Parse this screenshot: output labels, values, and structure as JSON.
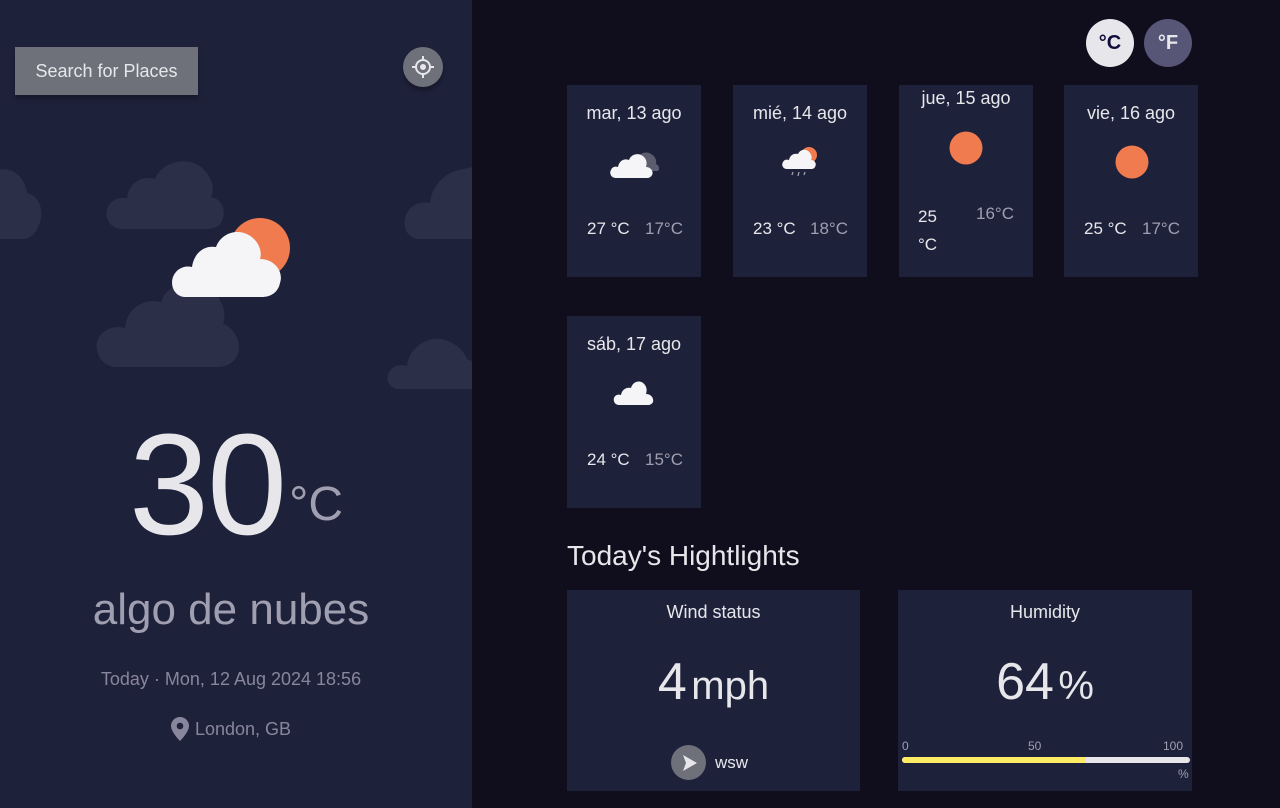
{
  "sidebar": {
    "search_label": "Search for Places",
    "locate_icon": "crosshair-icon",
    "weather_icon": "sun-behind-cloud-icon",
    "temp": "30",
    "temp_unit": "°C",
    "description": "algo de nubes",
    "date": "Today · Mon, 12 Aug 2024 18:56",
    "location_icon": "map-pin-icon",
    "location": "London, GB"
  },
  "units": {
    "celsius": "°C",
    "fahrenheit": "°F",
    "active": "celsius"
  },
  "forecast": [
    {
      "date": "mar, 13 ago",
      "icon": "overcast-clouds-icon",
      "max": "27 °C",
      "min": "17°C"
    },
    {
      "date": "mié, 14 ago",
      "icon": "sun-cloud-rain-icon",
      "max": "23 °C",
      "min": "18°C"
    },
    {
      "date": "jue, 15 ago",
      "icon": "sun-icon",
      "max": "25 °C",
      "min": "16°C"
    },
    {
      "date": "vie, 16 ago",
      "icon": "sun-icon",
      "max": "25 °C",
      "min": "17°C"
    },
    {
      "date": "sáb, 17 ago",
      "icon": "cloud-icon",
      "max": "24 °C",
      "min": "15°C"
    }
  ],
  "highlights": {
    "title": "Today's Hightlights",
    "wind": {
      "label": "Wind status",
      "value": "4",
      "unit": "mph",
      "direction": "wsw",
      "direction_icon": "navigation-arrow-icon"
    },
    "humidity": {
      "label": "Humidity",
      "value": "64",
      "unit": "%",
      "percent": 64,
      "scale": [
        "0",
        "50",
        "100"
      ],
      "scale_unit": "%"
    }
  },
  "colors": {
    "sidebar_bg": "#1e213a",
    "main_bg": "#100e1d",
    "card_bg": "#1e213a",
    "sun": "#ef7b4e",
    "humidity_bar": "#ffec65"
  }
}
